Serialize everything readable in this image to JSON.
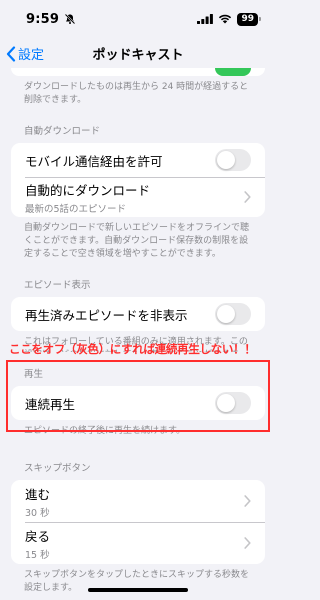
{
  "status_bar": {
    "time": "9:59",
    "battery": "99"
  },
  "nav": {
    "back_label": "設定",
    "title": "ポッドキャスト"
  },
  "top_section": {
    "footer": "ダウンロードしたものは再生から 24 時間が経過すると削除できます。"
  },
  "auto_download": {
    "header": "自動ダウンロード",
    "rows": [
      {
        "label": "モバイル通信経由を許可",
        "toggle": false
      },
      {
        "label": "自動的にダウンロード",
        "sub": "最新の5話のエピソード"
      }
    ],
    "footer": "自動ダウンロードで新しいエピソードをオフラインで聴くことができます。自動ダウンロード保存数の制限を設定することで空き領域を増やすことができます。"
  },
  "episode_display": {
    "header": "エピソード表示",
    "rows": [
      {
        "label": "再生済みエピソードを非表示",
        "toggle": false
      }
    ],
    "footer_1": "これはフォローしている番組のみに適用されます。この設定は、どの番組に対しても上書きすることができます。"
  },
  "playback": {
    "header": "再生",
    "rows": [
      {
        "label": "連続再生",
        "toggle": false
      }
    ],
    "footer": "エピソードの終了後に再生を続けます。"
  },
  "skip_buttons": {
    "header": "スキップボタン",
    "rows": [
      {
        "label": "進む",
        "sub": "30 秒"
      },
      {
        "label": "戻る",
        "sub": "15 秒"
      }
    ],
    "footer": "スキップボタンをタップしたときにスキップする秒数を設定します。"
  },
  "annotation": {
    "text": "ここをオフ（灰色）にすれば連続再生しない！！",
    "color": "#ff2d2d"
  },
  "colors": {
    "accent": "#007aff",
    "toggle_on": "#34c759",
    "toggle_off": "#e9e9eb"
  }
}
